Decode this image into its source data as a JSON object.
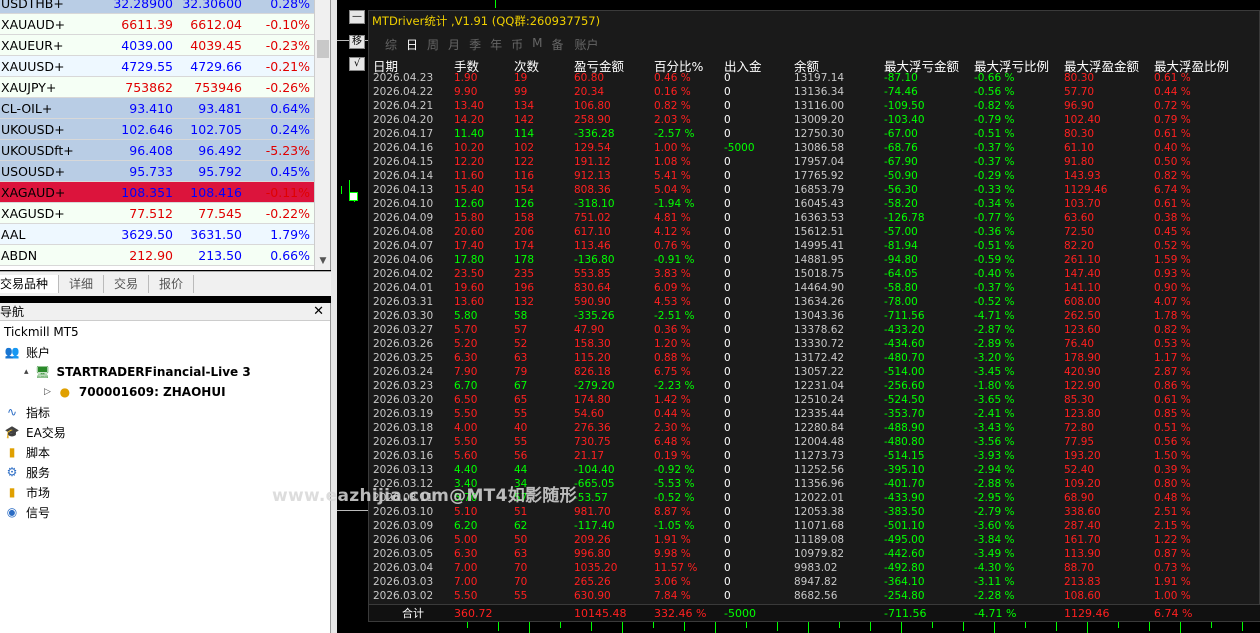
{
  "market_watch": {
    "rows": [
      {
        "symbol": "USDTHB+",
        "bid": "32.28900",
        "ask": "32.30600",
        "change": "0.28%",
        "bg": "#b9cde5",
        "chg_color": "#0000ff",
        "bid_color": "#0000ff",
        "ask_color": "#0000ff"
      },
      {
        "symbol": "XAUAUD+",
        "bid": "6611.39",
        "ask": "6612.04",
        "change": "-0.10%",
        "bg": "#f5fff5",
        "chg_color": "#e00000",
        "bid_color": "#e00000",
        "ask_color": "#e00000"
      },
      {
        "symbol": "XAUEUR+",
        "bid": "4039.00",
        "ask": "4039.45",
        "change": "-0.23%",
        "bg": "#f5fff5",
        "chg_color": "#e00000",
        "bid_color": "#0000ff",
        "ask_color": "#e00000"
      },
      {
        "symbol": "XAUUSD+",
        "bid": "4729.55",
        "ask": "4729.66",
        "change": "-0.21%",
        "bg": "#eef8ff",
        "chg_color": "#e00000",
        "bid_color": "#0000ff",
        "ask_color": "#0000ff"
      },
      {
        "symbol": "XAUJPY+",
        "bid": "753862",
        "ask": "753946",
        "change": "-0.26%",
        "bg": "#f5fff5",
        "chg_color": "#e00000",
        "bid_color": "#e00000",
        "ask_color": "#e00000"
      },
      {
        "symbol": "CL-OIL+",
        "bid": "93.410",
        "ask": "93.481",
        "change": "0.64%",
        "bg": "#b9cde5",
        "chg_color": "#0000ff",
        "bid_color": "#0000ff",
        "ask_color": "#0000ff"
      },
      {
        "symbol": "UKOUSD+",
        "bid": "102.646",
        "ask": "102.705",
        "change": "0.24%",
        "bg": "#b9cde5",
        "chg_color": "#0000ff",
        "bid_color": "#0000ff",
        "ask_color": "#0000ff"
      },
      {
        "symbol": "UKOUSDft+",
        "bid": "96.408",
        "ask": "96.492",
        "change": "-5.23%",
        "bg": "#b9cde5",
        "chg_color": "#e00000",
        "bid_color": "#0000ff",
        "ask_color": "#0000ff"
      },
      {
        "symbol": "USOUSD+",
        "bid": "95.733",
        "ask": "95.792",
        "change": "0.45%",
        "bg": "#b9cde5",
        "chg_color": "#0000ff",
        "bid_color": "#0000ff",
        "ask_color": "#0000ff"
      },
      {
        "symbol": "XAGAUD+",
        "bid": "108.351",
        "ask": "108.416",
        "change": "-0.11%",
        "bg": "#dc143c",
        "chg_color": "#e00000",
        "bid_color": "#0000ff",
        "ask_color": "#0000ff"
      },
      {
        "symbol": "XAGUSD+",
        "bid": "77.512",
        "ask": "77.545",
        "change": "-0.22%",
        "bg": "#f5fff5",
        "chg_color": "#e00000",
        "bid_color": "#e00000",
        "ask_color": "#e00000"
      },
      {
        "symbol": "AAL",
        "bid": "3629.50",
        "ask": "3631.50",
        "change": "1.79%",
        "bg": "#eef8ff",
        "chg_color": "#0000ff",
        "bid_color": "#0000ff",
        "ask_color": "#0000ff"
      },
      {
        "symbol": "ABDN",
        "bid": "212.90",
        "ask": "213.50",
        "change": "0.66%",
        "bg": "#f5fff5",
        "chg_color": "#0000ff",
        "bid_color": "#e00000",
        "ask_color": "#0000ff"
      }
    ],
    "tabs": [
      "交易品种",
      "详细",
      "交易",
      "报价"
    ]
  },
  "navigator": {
    "title": "导航",
    "close": "✕",
    "items": [
      {
        "label": "Tickmill MT5",
        "icon": "",
        "indent": 4,
        "bold": false,
        "expander": ""
      },
      {
        "label": "账户",
        "icon": "accounts-icon",
        "indent": 4,
        "bold": false,
        "expander": ""
      },
      {
        "label": "STARTRADERFinancial-Live 3",
        "icon": "server-icon",
        "indent": 24,
        "bold": true,
        "expander": "▴"
      },
      {
        "label": "700001609: ZHAOHUI",
        "icon": "user-icon",
        "indent": 44,
        "bold": true,
        "expander": "▷"
      },
      {
        "label": "指标",
        "icon": "indicators-icon",
        "indent": 4,
        "bold": false,
        "expander": ""
      },
      {
        "label": "EA交易",
        "icon": "expert-icon",
        "indent": 4,
        "bold": false,
        "expander": ""
      },
      {
        "label": "脚本",
        "icon": "script-icon",
        "indent": 4,
        "bold": false,
        "expander": ""
      },
      {
        "label": "服务",
        "icon": "service-icon",
        "indent": 4,
        "bold": false,
        "expander": ""
      },
      {
        "label": "市场",
        "icon": "market-icon",
        "indent": 4,
        "bold": false,
        "expander": ""
      },
      {
        "label": "信号",
        "icon": "signal-icon",
        "indent": 4,
        "bold": false,
        "expander": ""
      }
    ]
  },
  "chart_toolbar": [
    "—",
    "移",
    "√"
  ],
  "panel": {
    "title": "MTDriver统计 ,V1.91 (QQ群:260937757)",
    "tabs": [
      "综",
      "日",
      "周",
      "月",
      "季",
      "年",
      "币",
      "M",
      "备"
    ],
    "active_tab": 1,
    "extra_tab": "账户",
    "headers": [
      "日期",
      "手数",
      "次数",
      "盈亏金额",
      "百分比%",
      "出入金",
      "余额",
      "最大浮亏金额",
      "最大浮亏比例",
      "最大浮盈金额",
      "最大浮盈比例"
    ],
    "rows": [
      [
        "2026.04.23",
        "1.90",
        "19",
        "60.80",
        "0.46 %",
        "0",
        "13197.14",
        "-87.10",
        "-0.66 %",
        "80.30",
        "0.61 %"
      ],
      [
        "2026.04.22",
        "9.90",
        "99",
        "20.34",
        "0.16 %",
        "0",
        "13136.34",
        "-74.46",
        "-0.56 %",
        "57.70",
        "0.44 %"
      ],
      [
        "2026.04.21",
        "13.40",
        "134",
        "106.80",
        "0.82 %",
        "0",
        "13116.00",
        "-109.50",
        "-0.82 %",
        "96.90",
        "0.72 %"
      ],
      [
        "2026.04.20",
        "14.20",
        "142",
        "258.90",
        "2.03 %",
        "0",
        "13009.20",
        "-103.40",
        "-0.79 %",
        "102.40",
        "0.79 %"
      ],
      [
        "2026.04.17",
        "11.40",
        "114",
        "-336.28",
        "-2.57 %",
        "0",
        "12750.30",
        "-67.00",
        "-0.51 %",
        "80.30",
        "0.61 %"
      ],
      [
        "2026.04.16",
        "10.20",
        "102",
        "129.54",
        "1.00 %",
        "-5000",
        "13086.58",
        "-68.76",
        "-0.37 %",
        "61.10",
        "0.40 %"
      ],
      [
        "2026.04.15",
        "12.20",
        "122",
        "191.12",
        "1.08 %",
        "0",
        "17957.04",
        "-67.90",
        "-0.37 %",
        "91.80",
        "0.50 %"
      ],
      [
        "2026.04.14",
        "11.60",
        "116",
        "912.13",
        "5.41 %",
        "0",
        "17765.92",
        "-50.90",
        "-0.29 %",
        "143.93",
        "0.82 %"
      ],
      [
        "2026.04.13",
        "15.40",
        "154",
        "808.36",
        "5.04 %",
        "0",
        "16853.79",
        "-56.30",
        "-0.33 %",
        "1129.46",
        "6.74 %"
      ],
      [
        "2026.04.10",
        "12.60",
        "126",
        "-318.10",
        "-1.94 %",
        "0",
        "16045.43",
        "-58.20",
        "-0.34 %",
        "103.70",
        "0.61 %"
      ],
      [
        "2026.04.09",
        "15.80",
        "158",
        "751.02",
        "4.81 %",
        "0",
        "16363.53",
        "-126.78",
        "-0.77 %",
        "63.60",
        "0.38 %"
      ],
      [
        "2026.04.08",
        "20.60",
        "206",
        "617.10",
        "4.12 %",
        "0",
        "15612.51",
        "-57.00",
        "-0.36 %",
        "72.50",
        "0.45 %"
      ],
      [
        "2026.04.07",
        "17.40",
        "174",
        "113.46",
        "0.76 %",
        "0",
        "14995.41",
        "-81.94",
        "-0.51 %",
        "82.20",
        "0.52 %"
      ],
      [
        "2026.04.06",
        "17.80",
        "178",
        "-136.80",
        "-0.91 %",
        "0",
        "14881.95",
        "-94.80",
        "-0.59 %",
        "261.10",
        "1.59 %"
      ],
      [
        "2026.04.02",
        "23.50",
        "235",
        "553.85",
        "3.83 %",
        "0",
        "15018.75",
        "-64.05",
        "-0.40 %",
        "147.40",
        "0.93 %"
      ],
      [
        "2026.04.01",
        "19.60",
        "196",
        "830.64",
        "6.09 %",
        "0",
        "14464.90",
        "-58.80",
        "-0.37 %",
        "141.10",
        "0.90 %"
      ],
      [
        "2026.03.31",
        "13.60",
        "132",
        "590.90",
        "4.53 %",
        "0",
        "13634.26",
        "-78.00",
        "-0.52 %",
        "608.00",
        "4.07 %"
      ],
      [
        "2026.03.30",
        "5.80",
        "58",
        "-335.26",
        "-2.51 %",
        "0",
        "13043.36",
        "-711.56",
        "-4.71 %",
        "262.50",
        "1.78 %"
      ],
      [
        "2026.03.27",
        "5.70",
        "57",
        "47.90",
        "0.36 %",
        "0",
        "13378.62",
        "-433.20",
        "-2.87 %",
        "123.60",
        "0.82 %"
      ],
      [
        "2026.03.26",
        "5.20",
        "52",
        "158.30",
        "1.20 %",
        "0",
        "13330.72",
        "-434.60",
        "-2.89 %",
        "76.40",
        "0.53 %"
      ],
      [
        "2026.03.25",
        "6.30",
        "63",
        "115.20",
        "0.88 %",
        "0",
        "13172.42",
        "-480.70",
        "-3.20 %",
        "178.90",
        "1.17 %"
      ],
      [
        "2026.03.24",
        "7.90",
        "79",
        "826.18",
        "6.75 %",
        "0",
        "13057.22",
        "-514.00",
        "-3.45 %",
        "420.90",
        "2.87 %"
      ],
      [
        "2026.03.23",
        "6.70",
        "67",
        "-279.20",
        "-2.23 %",
        "0",
        "12231.04",
        "-256.60",
        "-1.80 %",
        "122.90",
        "0.86 %"
      ],
      [
        "2026.03.20",
        "6.50",
        "65",
        "174.80",
        "1.42 %",
        "0",
        "12510.24",
        "-524.50",
        "-3.65 %",
        "85.30",
        "0.61 %"
      ],
      [
        "2026.03.19",
        "5.50",
        "55",
        "54.60",
        "0.44 %",
        "0",
        "12335.44",
        "-353.70",
        "-2.41 %",
        "123.80",
        "0.85 %"
      ],
      [
        "2026.03.18",
        "4.00",
        "40",
        "276.36",
        "2.30 %",
        "0",
        "12280.84",
        "-488.90",
        "-3.43 %",
        "72.80",
        "0.51 %"
      ],
      [
        "2026.03.17",
        "5.50",
        "55",
        "730.75",
        "6.48 %",
        "0",
        "12004.48",
        "-480.80",
        "-3.56 %",
        "77.95",
        "0.56 %"
      ],
      [
        "2026.03.16",
        "5.60",
        "56",
        "21.17",
        "0.19 %",
        "0",
        "11273.73",
        "-514.15",
        "-3.93 %",
        "193.20",
        "1.50 %"
      ],
      [
        "2026.03.13",
        "4.40",
        "44",
        "-104.40",
        "-0.92 %",
        "0",
        "11252.56",
        "-395.10",
        "-2.94 %",
        "52.40",
        "0.39 %"
      ],
      [
        "2026.03.12",
        "3.40",
        "34",
        "-665.05",
        "-5.53 %",
        "0",
        "11356.96",
        "-401.70",
        "-2.88 %",
        "109.20",
        "0.80 %"
      ],
      [
        "2026.03.11",
        "5.70",
        "57",
        "-53.57",
        "-0.52 %",
        "0",
        "12022.01",
        "-433.90",
        "-2.95 %",
        "68.90",
        "0.48 %"
      ],
      [
        "2026.03.10",
        "5.10",
        "51",
        "981.70",
        "8.87 %",
        "0",
        "12053.38",
        "-383.50",
        "-2.79 %",
        "338.60",
        "2.51 %"
      ],
      [
        "2026.03.09",
        "6.20",
        "62",
        "-117.40",
        "-1.05 %",
        "0",
        "11071.68",
        "-501.10",
        "-3.60 %",
        "287.40",
        "2.15 %"
      ],
      [
        "2026.03.06",
        "5.00",
        "50",
        "209.26",
        "1.91 %",
        "0",
        "11189.08",
        "-495.00",
        "-3.84 %",
        "161.70",
        "1.22 %"
      ],
      [
        "2026.03.05",
        "6.30",
        "63",
        "996.80",
        "9.98 %",
        "0",
        "10979.82",
        "-442.60",
        "-3.49 %",
        "113.90",
        "0.87 %"
      ],
      [
        "2026.03.04",
        "7.00",
        "70",
        "1035.20",
        "11.57 %",
        "0",
        "9983.02",
        "-492.80",
        "-4.30 %",
        "88.70",
        "0.73 %"
      ],
      [
        "2026.03.03",
        "7.00",
        "70",
        "265.26",
        "3.06 %",
        "0",
        "8947.82",
        "-364.10",
        "-3.11 %",
        "213.83",
        "1.91 %"
      ],
      [
        "2026.03.02",
        "5.50",
        "55",
        "630.90",
        "7.84 %",
        "0",
        "8682.56",
        "-254.80",
        "-2.28 %",
        "108.60",
        "1.00 %"
      ]
    ],
    "footer": {
      "label": "合计",
      "lots": "360.72",
      "pl": "10145.48",
      "pct": "332.46 %",
      "deposit": "-5000",
      "mfl": "-711.56",
      "mflp": "-4.71 %",
      "mfp": "1129.46",
      "mfpp": "6.74 %"
    }
  },
  "watermark": "www.eazhijia.com@MT4如影随形",
  "colors": {
    "profit": "#ff2020",
    "loss": "#00ff00",
    "title": "#f0d000"
  }
}
